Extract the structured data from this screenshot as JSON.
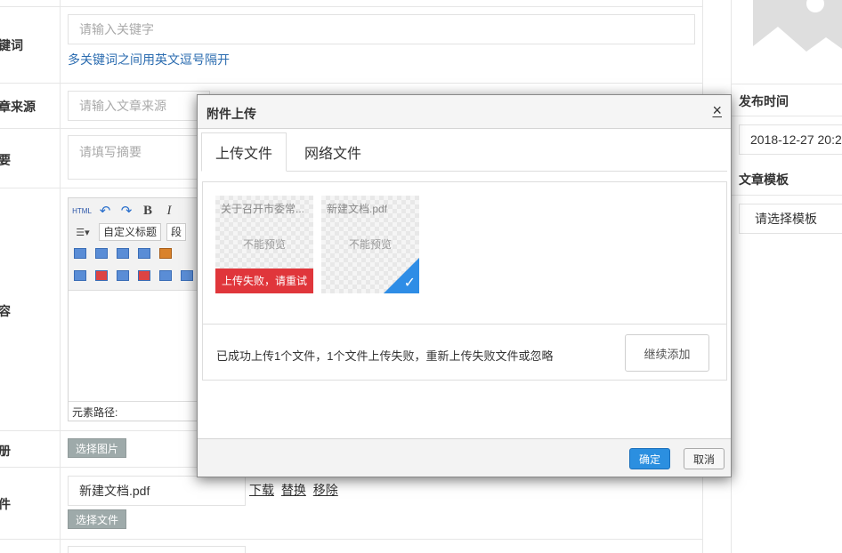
{
  "form": {
    "keywords_label": "键词",
    "keywords_placeholder": "请输入关键字",
    "keywords_hint": "多关键词之间用英文逗号隔开",
    "source_label": "章来源",
    "source_placeholder": "请输入文章来源",
    "summary_label": "要",
    "summary_placeholder": "请填写摘要",
    "content_label": "容",
    "editor": {
      "html_label": "HTML",
      "bold_label": "B",
      "italic_label": "I",
      "title_select": "自定义标题",
      "para_select": "段",
      "path_label": "元素路径:"
    },
    "images_label": "册",
    "select_image_btn": "选择图片",
    "file_label": "件",
    "file_value": "新建文档.pdf",
    "file_links": [
      "下载",
      "替换",
      "移除"
    ],
    "select_file_btn": "选择文件"
  },
  "right_panel": {
    "publish_time_label": "发布时间",
    "publish_time_value": "2018-12-27 20:2",
    "template_label": "文章模板",
    "template_value": "请选择模板"
  },
  "dialog": {
    "title": "附件上传",
    "close": "×",
    "tabs": [
      "上传文件",
      "网络文件"
    ],
    "files": [
      {
        "name": "关于召开市委常...",
        "preview": "不能预览",
        "status": "error",
        "status_text": "上传失败，请重试"
      },
      {
        "name": "新建文档.pdf",
        "preview": "不能预览",
        "status": "success",
        "status_text": "✓"
      }
    ],
    "status_text": "已成功上传1个文件，1个文件上传失败，重新上传失败文件或忽略",
    "continue_btn": "继续添加",
    "ok_btn": "确定",
    "cancel_btn": "取消"
  },
  "colors": {
    "accent": "#2b8fe0",
    "error": "#e0363b",
    "hint": "#2b6cb0"
  }
}
